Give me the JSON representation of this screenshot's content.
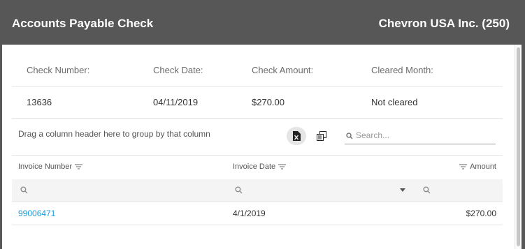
{
  "header": {
    "title": "Accounts Payable Check",
    "vendor": "Chevron USA Inc. (250)"
  },
  "summary": {
    "labels": {
      "check_number": "Check Number:",
      "check_date": "Check Date:",
      "check_amount": "Check Amount:",
      "cleared_month": "Cleared Month:"
    },
    "values": {
      "check_number": "13636",
      "check_date": "04/11/2019",
      "check_amount": "$270.00",
      "cleared_month": "Not cleared"
    }
  },
  "grid": {
    "group_panel_text": "Drag a column header here to group by that column",
    "search_placeholder": "Search...",
    "columns": {
      "invoice_number": "Invoice Number",
      "invoice_date": "Invoice Date",
      "amount": "Amount"
    },
    "rows": [
      {
        "invoice_number": "99006471",
        "invoice_date": "4/1/2019",
        "amount": "$270.00"
      }
    ]
  },
  "icons": [
    "excel-export-icon",
    "column-chooser-icon",
    "search-icon",
    "filter-icon",
    "chevron-down-icon"
  ],
  "colors": {
    "header_bg": "#575757",
    "link": "#1a9bd8"
  }
}
